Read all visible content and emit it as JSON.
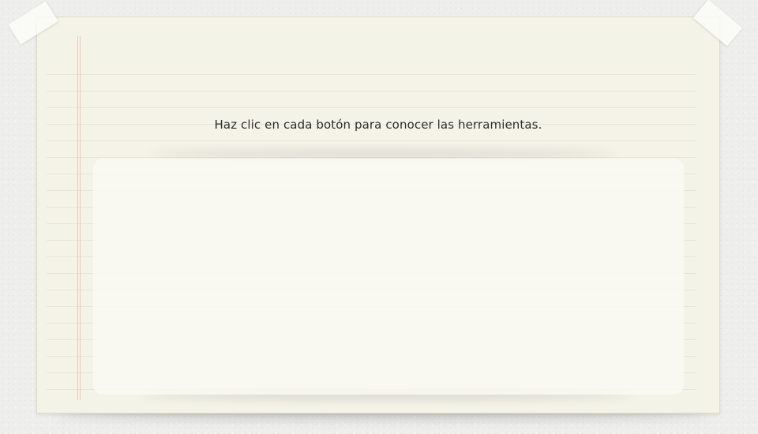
{
  "instruction": {
    "text": "Haz clic en cada botón para conocer las herramientas."
  },
  "colors": {
    "background": "#eeeeec",
    "paper": "#f4f3e8",
    "ruled_line": "#e6e5d6",
    "margin_line": "#f0c9b4",
    "text": "#2e2e2e",
    "panel": "#fafaf4"
  }
}
